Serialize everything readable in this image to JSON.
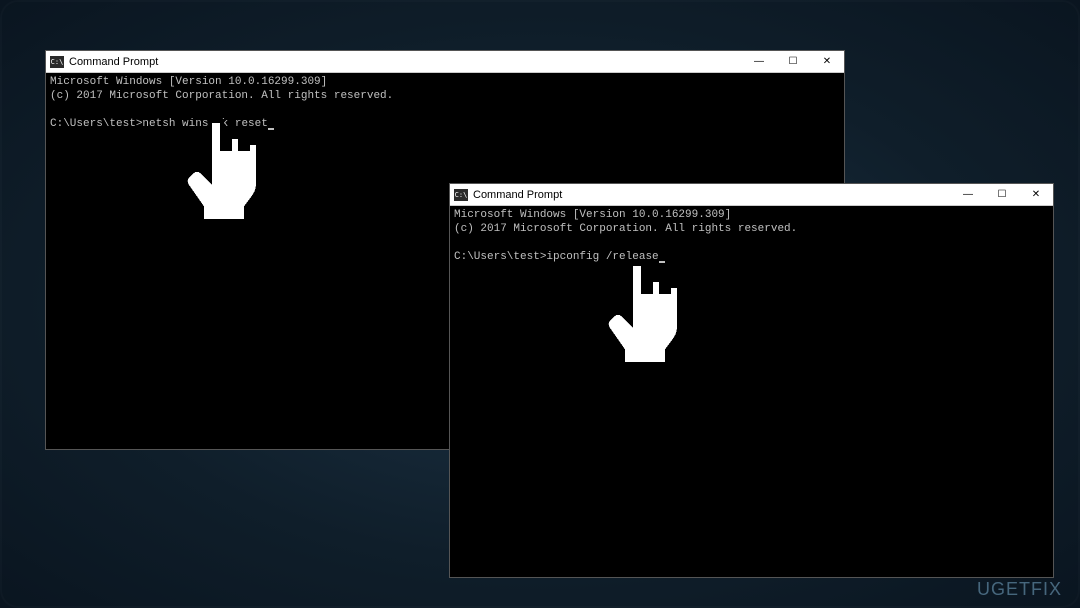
{
  "watermark": "UGETFIX",
  "windows": [
    {
      "title": "Command Prompt",
      "icon_label": "C:\\",
      "header_line1": "Microsoft Windows [Version 10.0.16299.309]",
      "header_line2": "(c) 2017 Microsoft Corporation. All rights reserved.",
      "prompt": "C:\\Users\\test>",
      "command": "netsh winsock reset",
      "controls": {
        "min": "—",
        "max": "☐",
        "close": "✕"
      }
    },
    {
      "title": "Command Prompt",
      "icon_label": "C:\\",
      "header_line1": "Microsoft Windows [Version 10.0.16299.309]",
      "header_line2": "(c) 2017 Microsoft Corporation. All rights reserved.",
      "prompt": "C:\\Users\\test>",
      "command": "ipconfig /release",
      "controls": {
        "min": "—",
        "max": "☐",
        "close": "✕"
      }
    }
  ]
}
